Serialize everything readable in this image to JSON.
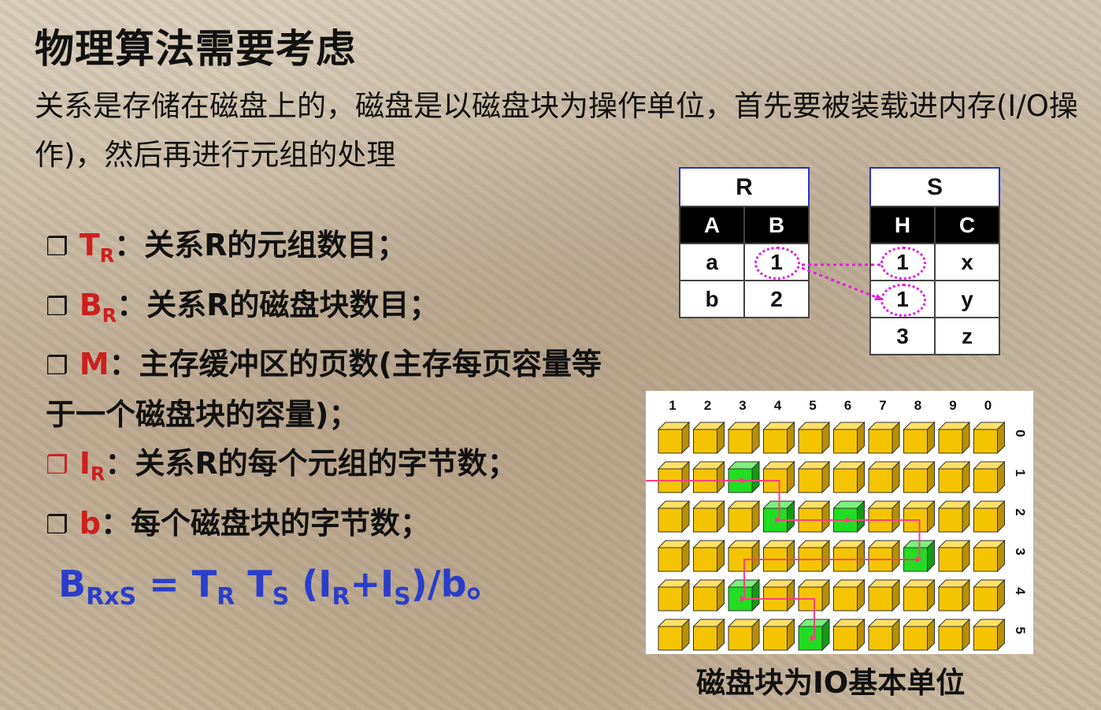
{
  "title": "物理算法需要考虑",
  "intro": "关系是存储在磁盘上的，磁盘是以磁盘块为操作单位，首先要被装载进内存(I/O操作)，然后再进行元组的处理",
  "bullets": [
    {
      "box": "❐",
      "sym": "T",
      "sub": "R",
      "text": "：关系R的元组数目；"
    },
    {
      "box": "❐",
      "sym": "B",
      "sub": "R",
      "text": "：关系R的磁盘块数目；"
    },
    {
      "box": "❐",
      "sym": "M",
      "sub": "",
      "text": "：主存缓冲区的页数(主存每页容量等于一个磁盘块的容量)；"
    },
    {
      "box": "❐",
      "sym": "I",
      "sub": "R",
      "text": "：关系R的每个元组的字节数；"
    },
    {
      "box": "❐",
      "sym": "b",
      "sub": "",
      "text": "：每个磁盘块的字节数；"
    }
  ],
  "formula": {
    "b": "B",
    "b_sub": "RxS",
    "eq": " = ",
    "t1": "T",
    "t1_sub": "R",
    "t2": " T",
    "t2_sub": "S",
    "open": " (I",
    "i1_sub": "R",
    "plus": "+I",
    "i2_sub": "S",
    "close": ")/b。"
  },
  "table_r": {
    "name": "R",
    "cols": [
      "A",
      "B"
    ],
    "rows": [
      [
        "a",
        "1"
      ],
      [
        "b",
        "2"
      ]
    ]
  },
  "table_s": {
    "name": "S",
    "cols": [
      "H",
      "C"
    ],
    "rows": [
      [
        "1",
        "x"
      ],
      [
        "1",
        "y"
      ],
      [
        "3",
        "z"
      ]
    ]
  },
  "disk": {
    "col_labels": [
      "1",
      "2",
      "3",
      "4",
      "5",
      "6",
      "7",
      "8",
      "9",
      "0"
    ],
    "row_labels": [
      "0",
      "1",
      "2",
      "3",
      "4",
      "5"
    ],
    "green_blocks": [
      [
        1,
        2
      ],
      [
        2,
        3
      ],
      [
        2,
        5
      ],
      [
        3,
        7
      ],
      [
        4,
        2
      ],
      [
        5,
        4
      ]
    ],
    "block_color": "#f5c400",
    "active_color": "#22dd22",
    "path_color": "#ff3f80"
  },
  "caption": "磁盘块为IO基本单位"
}
